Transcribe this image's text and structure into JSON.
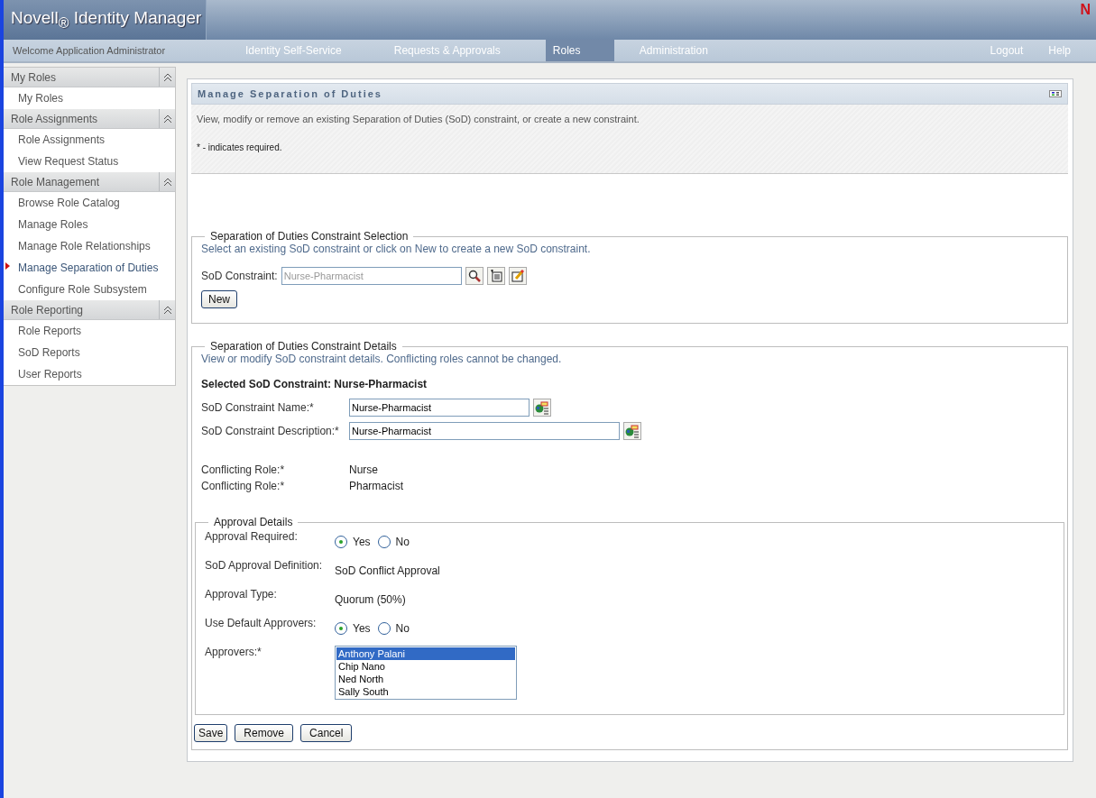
{
  "header": {
    "brand": "Novell",
    "registered": "®",
    "product": "Identity Manager",
    "logo_mark": "N"
  },
  "nav": {
    "welcome": "Welcome Application Administrator",
    "tabs": [
      {
        "label": "Identity Self-Service",
        "selected": false
      },
      {
        "label": "Requests & Approvals",
        "selected": false
      },
      {
        "label": "Roles",
        "selected": true
      },
      {
        "label": "Administration",
        "selected": false
      }
    ],
    "links": [
      "Logout",
      "Help"
    ]
  },
  "sidebar": {
    "sections": [
      {
        "title": "My Roles",
        "items": [
          {
            "label": "My Roles",
            "selected": false
          }
        ]
      },
      {
        "title": "Role Assignments",
        "items": [
          {
            "label": "Role Assignments",
            "selected": false
          },
          {
            "label": "View Request Status",
            "selected": false
          }
        ]
      },
      {
        "title": "Role Management",
        "items": [
          {
            "label": "Browse Role Catalog",
            "selected": false
          },
          {
            "label": "Manage Roles",
            "selected": false
          },
          {
            "label": "Manage Role Relationships",
            "selected": false
          },
          {
            "label": "Manage Separation of Duties",
            "selected": true
          },
          {
            "label": "Configure Role Subsystem",
            "selected": false
          }
        ]
      },
      {
        "title": "Role Reporting",
        "items": [
          {
            "label": "Role Reports",
            "selected": false
          },
          {
            "label": "SoD Reports",
            "selected": false
          },
          {
            "label": "User Reports",
            "selected": false
          }
        ]
      }
    ]
  },
  "panel": {
    "title": "Manage Separation of Duties",
    "intro": "View, modify or remove an existing Separation of Duties (SoD) constraint, or create a new constraint.",
    "required_note": "* - indicates required.",
    "selection": {
      "legend": "Separation of Duties Constraint Selection",
      "hint": "Select an existing SoD constraint or click on New to create a new SoD constraint.",
      "field_label": "SoD Constraint:",
      "field_value": "Nurse-Pharmacist",
      "new_button": "New"
    },
    "details": {
      "legend": "Separation of Duties Constraint Details",
      "hint": "View or modify SoD constraint details. Conflicting roles cannot be changed.",
      "selected_label": "Selected SoD Constraint: Nurse-Pharmacist",
      "name_label": "SoD Constraint Name:*",
      "name_value": "Nurse-Pharmacist",
      "description_label": "SoD Constraint Description:*",
      "description_value": "Nurse-Pharmacist",
      "conflicting_roles": [
        {
          "label": "Conflicting Role:*",
          "value": "Nurse"
        },
        {
          "label": "Conflicting Role:*",
          "value": "Pharmacist"
        }
      ],
      "approval": {
        "legend": "Approval Details",
        "rows": [
          {
            "kind": "radio",
            "label": "Approval Required:",
            "options": [
              {
                "label": "Yes",
                "selected": true
              },
              {
                "label": "No",
                "selected": false
              }
            ]
          },
          {
            "kind": "text",
            "label": "SoD Approval Definition:",
            "value": "SoD Conflict Approval"
          },
          {
            "kind": "text",
            "label": "Approval Type:",
            "value": "Quorum  (50%)"
          },
          {
            "kind": "radio",
            "label": "Use Default Approvers:",
            "options": [
              {
                "label": "Yes",
                "selected": true
              },
              {
                "label": "No",
                "selected": false
              }
            ]
          },
          {
            "kind": "list",
            "label": "Approvers:*",
            "items": [
              {
                "label": "Anthony Palani",
                "selected": true
              },
              {
                "label": "Chip Nano",
                "selected": false
              },
              {
                "label": "Ned North",
                "selected": false
              },
              {
                "label": "Sally South",
                "selected": false
              }
            ]
          }
        ]
      }
    },
    "buttons": [
      "Save",
      "Remove",
      "Cancel"
    ]
  }
}
